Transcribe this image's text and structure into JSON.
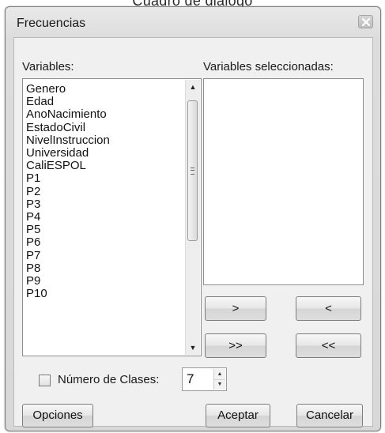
{
  "caption": "Cuadro de diálogo",
  "window": {
    "title": "Frecuencias"
  },
  "icons": {
    "close": "close-icon",
    "scroll_up": "scroll-up-arrow-icon",
    "scroll_down": "scroll-down-arrow-icon",
    "spin_up": "spin-up-arrow-icon",
    "spin_down": "spin-down-arrow-icon"
  },
  "variables": {
    "label": "Variables:",
    "items": [
      "Genero",
      "Edad",
      "AnoNacimiento",
      "EstadoCivil",
      "NivelInstruccion",
      "Universidad",
      "CaliESPOL",
      "P1",
      "P2",
      "P3",
      "P4",
      "P5",
      "P6",
      "P7",
      "P8",
      "P9",
      "P10"
    ]
  },
  "selected_variables": {
    "label": "Variables seleccionadas:",
    "items": []
  },
  "transfer_buttons": {
    "add": ">",
    "remove": "<",
    "add_all": ">>",
    "remove_all": "<<"
  },
  "classes": {
    "label": "Número de Clases:",
    "checked": false,
    "value": "7"
  },
  "footer": {
    "options": "Opciones",
    "accept": "Aceptar",
    "cancel": "Cancelar"
  }
}
